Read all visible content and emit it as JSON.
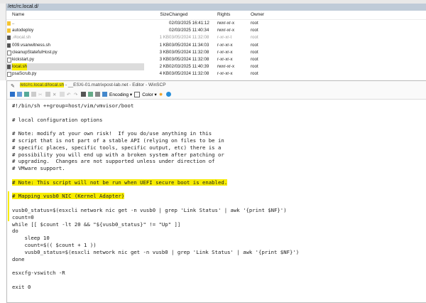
{
  "browser": {
    "path": "/etc/rc.local.d/",
    "columns": [
      "Name",
      "Size",
      "Changed",
      "Rights",
      "Owner"
    ],
    "files": [
      {
        "name": "..",
        "size": "",
        "changed": "02/03/2025 16:41:12",
        "rights": "rwxr-xr-x",
        "owner": "root",
        "icon": "parent-folder"
      },
      {
        "name": "autodeploy",
        "size": "",
        "changed": "02/03/2025 11:40:34",
        "rights": "rwxr-xr-x",
        "owner": "root",
        "icon": "folder"
      },
      {
        "name": ".#local.sh",
        "size": "1 KB",
        "changed": "03/05/2024 11:32:08",
        "rights": "r-xr-xr-t",
        "owner": "root",
        "icon": "exe"
      },
      {
        "name": "009.vsanwitness.sh",
        "size": "1 KB",
        "changed": "03/05/2024 11:34:03",
        "rights": "r-xr-xr-x",
        "owner": "root",
        "icon": "exe"
      },
      {
        "name": "cleanupStatefulHost.py",
        "size": "3 KB",
        "changed": "03/05/2024 11:32:08",
        "rights": "r-xr-xr-x",
        "owner": "root",
        "icon": "file"
      },
      {
        "name": "kickstart.py",
        "size": "3 KB",
        "changed": "03/05/2024 11:32:08",
        "rights": "r-xr-xr-x",
        "owner": "root",
        "icon": "file"
      },
      {
        "name": "local.sh",
        "size": "2 KB",
        "changed": "02/03/2025 11:40:39",
        "rights": "rwxr-xr-x",
        "owner": "root",
        "icon": "exe"
      },
      {
        "name": "psaScrub.py",
        "size": "4 KB",
        "changed": "03/05/2024 11:32:08",
        "rights": "r-xr-xr-x",
        "owner": "root",
        "icon": "file"
      }
    ]
  },
  "editor": {
    "title_path": "/etc/rc.local.d/local.sh",
    "title_rest": " - __ESXi-01.matrixpost-lab.net - Editor - WinSCP",
    "encoding": "Encoding",
    "color": "Color",
    "lines": [
      "#!/bin/sh ++group=host/vim/vmvisor/boot",
      "",
      "# local configuration options",
      "",
      "# Note: modify at your own risk!  If you do/use anything in this",
      "# script that is not part of a stable API (relying on files to be in",
      "# specific places, specific tools, specific output, etc) there is a",
      "# possibility you will end up with a broken system after patching or",
      "# upgrading.  Changes are not supported unless under direction of",
      "# VMware support.",
      "",
      "# Note: This script will not be run when UEFI secure boot is enabled.",
      "",
      "# Mapping vusb0 NIC (Kernel Adapter)",
      "",
      "vusb0_status=$(esxcli network nic get -n vusb0 | grep 'Link Status' | awk '{print $NF}')",
      "count=0",
      "while [[ $count -lt 20 && \"${vusb0_status}\" != \"Up\" ]]",
      "do",
      "    sleep 10",
      "    count=$(( $count + 1 ))",
      "    vusb0_status=$(esxcli network nic get -n vusb0 | grep 'Link Status' | awk '{print $NF}')",
      "done",
      "",
      "esxcfg-vswitch -R",
      "",
      "exit 0"
    ]
  },
  "colors": {
    "highlight": "#f7ec00"
  }
}
